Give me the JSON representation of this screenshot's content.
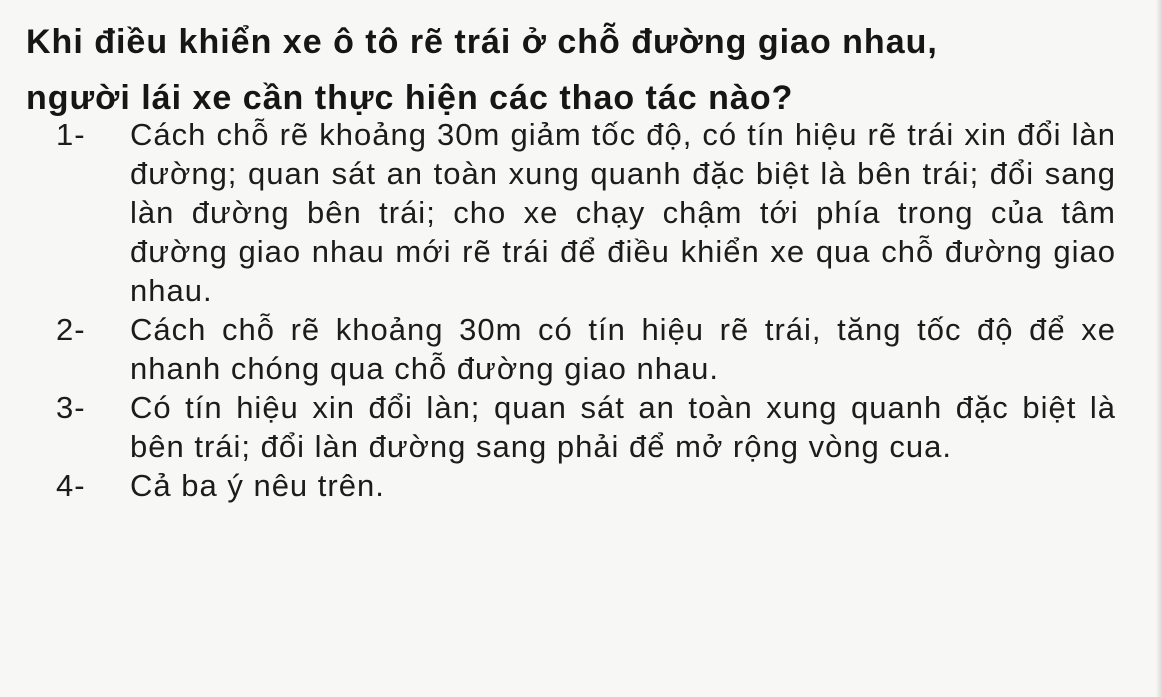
{
  "question": {
    "lines": [
      "Khi điều khiển xe ô tô rẽ trái ở chỗ đường giao nhau,",
      "người lái xe cần thực hiện các thao tác nào?"
    ]
  },
  "answers": [
    {
      "number": "1-",
      "text": "Cách chỗ rẽ khoảng 30m giảm tốc độ, có tín hiệu rẽ trái xin đổi làn đường; quan sát an toàn xung quanh đặc biệt là bên trái; đổi sang làn đường bên trái; cho xe chạy chậm tới phía trong của tâm đường giao nhau mới rẽ trái để điều khiển xe qua chỗ đường giao nhau."
    },
    {
      "number": "2-",
      "text": "Cách chỗ rẽ khoảng 30m có tín hiệu rẽ trái, tăng tốc độ để xe nhanh chóng qua chỗ đường giao nhau."
    },
    {
      "number": "3-",
      "text": "Có tín hiệu xin đổi làn; quan sát an toàn xung quanh đặc biệt là bên trái; đổi làn đường sang phải để mở rộng vòng cua."
    },
    {
      "number": "4-",
      "text": "Cả ba ý nêu trên."
    }
  ]
}
